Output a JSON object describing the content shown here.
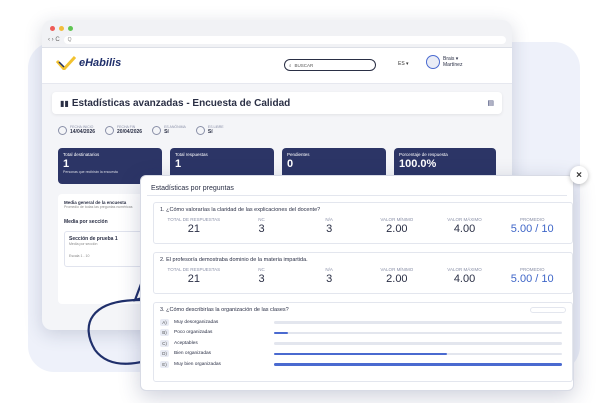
{
  "browser": {
    "url_icons": "‹ › C",
    "search_hint": "Q"
  },
  "header": {
    "logo": "eHabilis",
    "search_placeholder": "BUSCAR",
    "lang": "ES ▾",
    "user_first": "Brais ▾",
    "user_last": "Martínez"
  },
  "page": {
    "title": "Estadísticas avanzadas - Encuesta de Calidad"
  },
  "info": [
    {
      "label": "Fecha inicio",
      "value": "14/04/2026"
    },
    {
      "label": "Fecha fin",
      "value": "20/04/2026"
    },
    {
      "label": "Es anónima",
      "value": "Sí"
    },
    {
      "label": "Es libre",
      "value": "Sí"
    }
  ],
  "stats": [
    {
      "label": "Total destinatarios",
      "value": "1",
      "sub": "Personas que recibirán la encuesta"
    },
    {
      "label": "Total respuestas",
      "value": "1",
      "sub": ""
    },
    {
      "label": "Pendientes",
      "value": "0",
      "sub": ""
    },
    {
      "label": "Porcentaje de respuesta",
      "value": "100.0%",
      "sub": ""
    }
  ],
  "left": {
    "general": "Media general de la encuesta",
    "general_sub": "Promedio de todas las preguntas numéricas",
    "section_title": "Media por sección",
    "section_name": "Sección de prueba 1",
    "section_sub": "Media por sección",
    "section_range": "Escala 1 - 10"
  },
  "popup": {
    "title": "Estadísticas por preguntas",
    "close": "×",
    "col_labels": [
      "TOTAL DE RESPUESTAS",
      "NC",
      "N/A",
      "VALOR MÍNIMO",
      "VALOR MÁXIMO",
      "PROMEDIO"
    ],
    "q1": {
      "text": "1. ¿Cómo valorarías la claridad de las explicaciones del docente?",
      "values": [
        "21",
        "3",
        "3",
        "2.00",
        "4.00",
        "5.00 / 10"
      ]
    },
    "q2": {
      "text": "2. El profesor/a demostraba dominio de la materia impartida.",
      "values": [
        "21",
        "3",
        "3",
        "2.00",
        "4.00",
        "5.00 / 10"
      ]
    },
    "q3": {
      "text": "3. ¿Cómo describirías la organización de las clases?",
      "options": [
        {
          "key": "A)",
          "label": "Muy desorganizadas",
          "fraction": 0
        },
        {
          "key": "B)",
          "label": "Poco organizadas",
          "fraction": 0.05
        },
        {
          "key": "C)",
          "label": "Aceptables",
          "fraction": 0
        },
        {
          "key": "D)",
          "label": "Bien organizadas",
          "fraction": 0.6
        },
        {
          "key": "E)",
          "label": "Muy bien organizadas",
          "fraction": 1
        }
      ]
    }
  },
  "colors": {
    "navy": "#2c3566",
    "accent": "#4a6ad0",
    "logo_yellow": "#f2c230"
  }
}
